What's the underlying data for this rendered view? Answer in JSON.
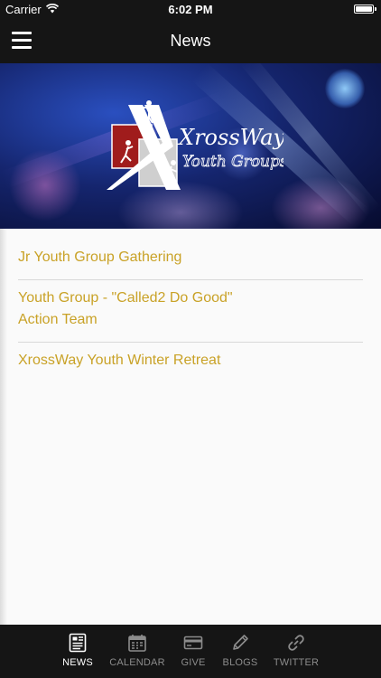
{
  "status_bar": {
    "carrier": "Carrier",
    "time": "6:02 PM"
  },
  "nav": {
    "title": "News",
    "menu_icon": "hamburger-menu-icon"
  },
  "hero": {
    "logo_line1": "XrossWay",
    "logo_line2": "Youth Groups"
  },
  "news": {
    "items": [
      {
        "title": "Jr Youth Group Gathering"
      },
      {
        "title": "Youth Group - \"Called2 Do Good\"\nAction Team"
      },
      {
        "title": "XrossWay Youth Winter Retreat"
      }
    ]
  },
  "tabs": [
    {
      "label": "NEWS",
      "icon": "newspaper-icon",
      "active": true
    },
    {
      "label": "CALENDAR",
      "icon": "calendar-icon",
      "active": false
    },
    {
      "label": "GIVE",
      "icon": "credit-card-icon",
      "active": false
    },
    {
      "label": "BLOGS",
      "icon": "pencil-icon",
      "active": false
    },
    {
      "label": "TWITTER",
      "icon": "link-icon",
      "active": false
    }
  ],
  "colors": {
    "accent": "#c9a227",
    "bar": "#151515",
    "tab_inactive": "#8c8c8c"
  }
}
